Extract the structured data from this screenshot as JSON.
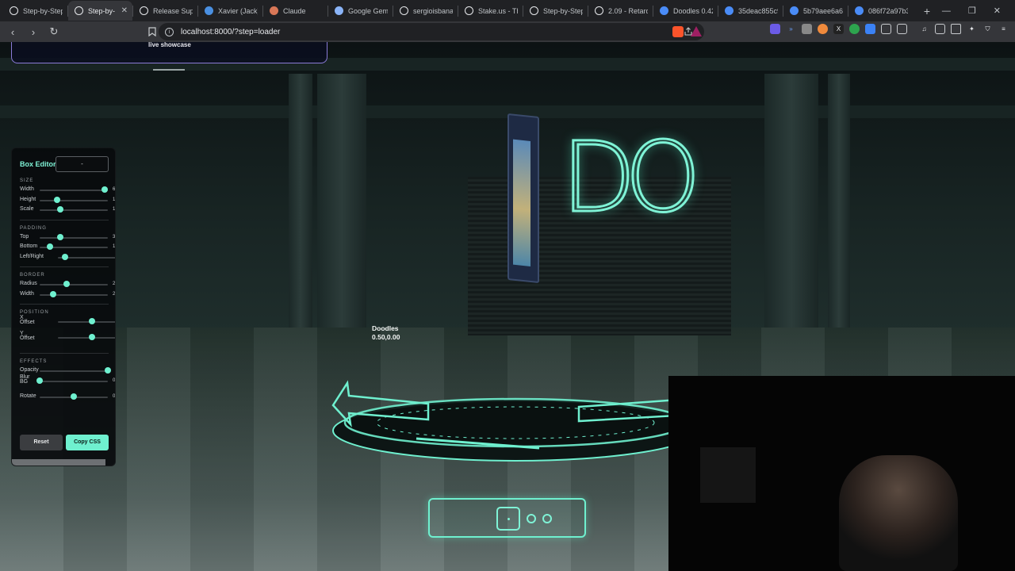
{
  "browser": {
    "tabs": [
      {
        "title": "Step-by-Step",
        "icon": "x-logo-icon",
        "color": "#ffffff",
        "active": false
      },
      {
        "title": "Step-by-",
        "icon": "x-logo-icon",
        "color": "#ffffff",
        "active": true
      },
      {
        "title": "Release Supe",
        "icon": "github-icon",
        "color": "#ffffff",
        "active": false
      },
      {
        "title": "Xavier (Jack)",
        "icon": "xavier-icon",
        "color": "#4a90e2",
        "active": false
      },
      {
        "title": "Claude",
        "icon": "claude-icon",
        "color": "#d97757",
        "active": false
      },
      {
        "title": "Google Gem",
        "icon": "gemini-icon",
        "color": "#8ab4f8",
        "active": false
      },
      {
        "title": "sergioisbanan",
        "icon": "github-icon",
        "color": "#ffffff",
        "active": false
      },
      {
        "title": "Stake.us - The",
        "icon": "stake-icon",
        "color": "#ffffff",
        "active": false
      },
      {
        "title": "Step-by-Step",
        "icon": "x-logo-icon",
        "color": "#ffffff",
        "active": false
      },
      {
        "title": "2.09 - Retard",
        "icon": "arrow-icon",
        "color": "#ffffff",
        "active": false
      },
      {
        "title": "Doodles 0.42",
        "icon": "doodles-icon",
        "color": "#4a8cf7",
        "active": false
      },
      {
        "title": "35deac855c9",
        "icon": "doodles-icon",
        "color": "#4a8cf7",
        "active": false
      },
      {
        "title": "5b79aee6a63",
        "icon": "doodles-icon",
        "color": "#4a8cf7",
        "active": false
      },
      {
        "title": "086f72a97b3",
        "icon": "doodles-icon",
        "color": "#4a8cf7",
        "active": false
      }
    ],
    "new_tab": "+",
    "window_controls": {
      "minimize": "—",
      "restore": "❐",
      "close": "✕"
    },
    "url": "localhost:8000/?step=loader",
    "nav": {
      "back": "‹",
      "forward": "›",
      "reload": "↻"
    }
  },
  "scene": {
    "top_card_text": "live showcase",
    "neon_text": "DO",
    "doodle_label": {
      "name": "Doodles",
      "coords": "0.50,0.00"
    },
    "accent_color": "#6ff0cf",
    "steps": {
      "total": 3,
      "active": 1
    }
  },
  "box_editor": {
    "title": "Box Editor",
    "select_value": "-",
    "sections": [
      {
        "label": "SIZE",
        "rows": [
          {
            "label": "Width",
            "value": "66",
            "level": 0.95
          },
          {
            "label": "Height",
            "value": "1",
            "level": 0.25
          },
          {
            "label": "Scale",
            "value": "1.",
            "level": 0.3
          }
        ]
      },
      {
        "label": "PADDING",
        "rows": [
          {
            "label": "Top",
            "value": "30",
            "level": 0.3
          },
          {
            "label": "Bottom",
            "value": "1",
            "level": 0.15
          },
          {
            "label": "Left/Right",
            "value": "",
            "level": 0.1
          }
        ]
      },
      {
        "label": "BORDER",
        "rows": [
          {
            "label": "Radius",
            "value": "2",
            "level": 0.4
          },
          {
            "label": "Width",
            "value": "2",
            "level": 0.2
          }
        ]
      },
      {
        "label": "POSITION",
        "rows": [
          {
            "label": "X Offset",
            "value": "0",
            "level": 0.5
          },
          {
            "label": "Y Offset",
            "value": "0",
            "level": 0.5
          }
        ]
      },
      {
        "label": "EFFECTS",
        "rows": [
          {
            "label": "Opacity",
            "value": "",
            "level": 1.0
          },
          {
            "label": "Blur BG",
            "value": "0",
            "level": 0.0
          },
          {
            "label": "Rotate",
            "value": "0",
            "level": 0.5
          }
        ]
      }
    ],
    "reset_label": "Reset",
    "copy_label": "Copy CSS"
  }
}
